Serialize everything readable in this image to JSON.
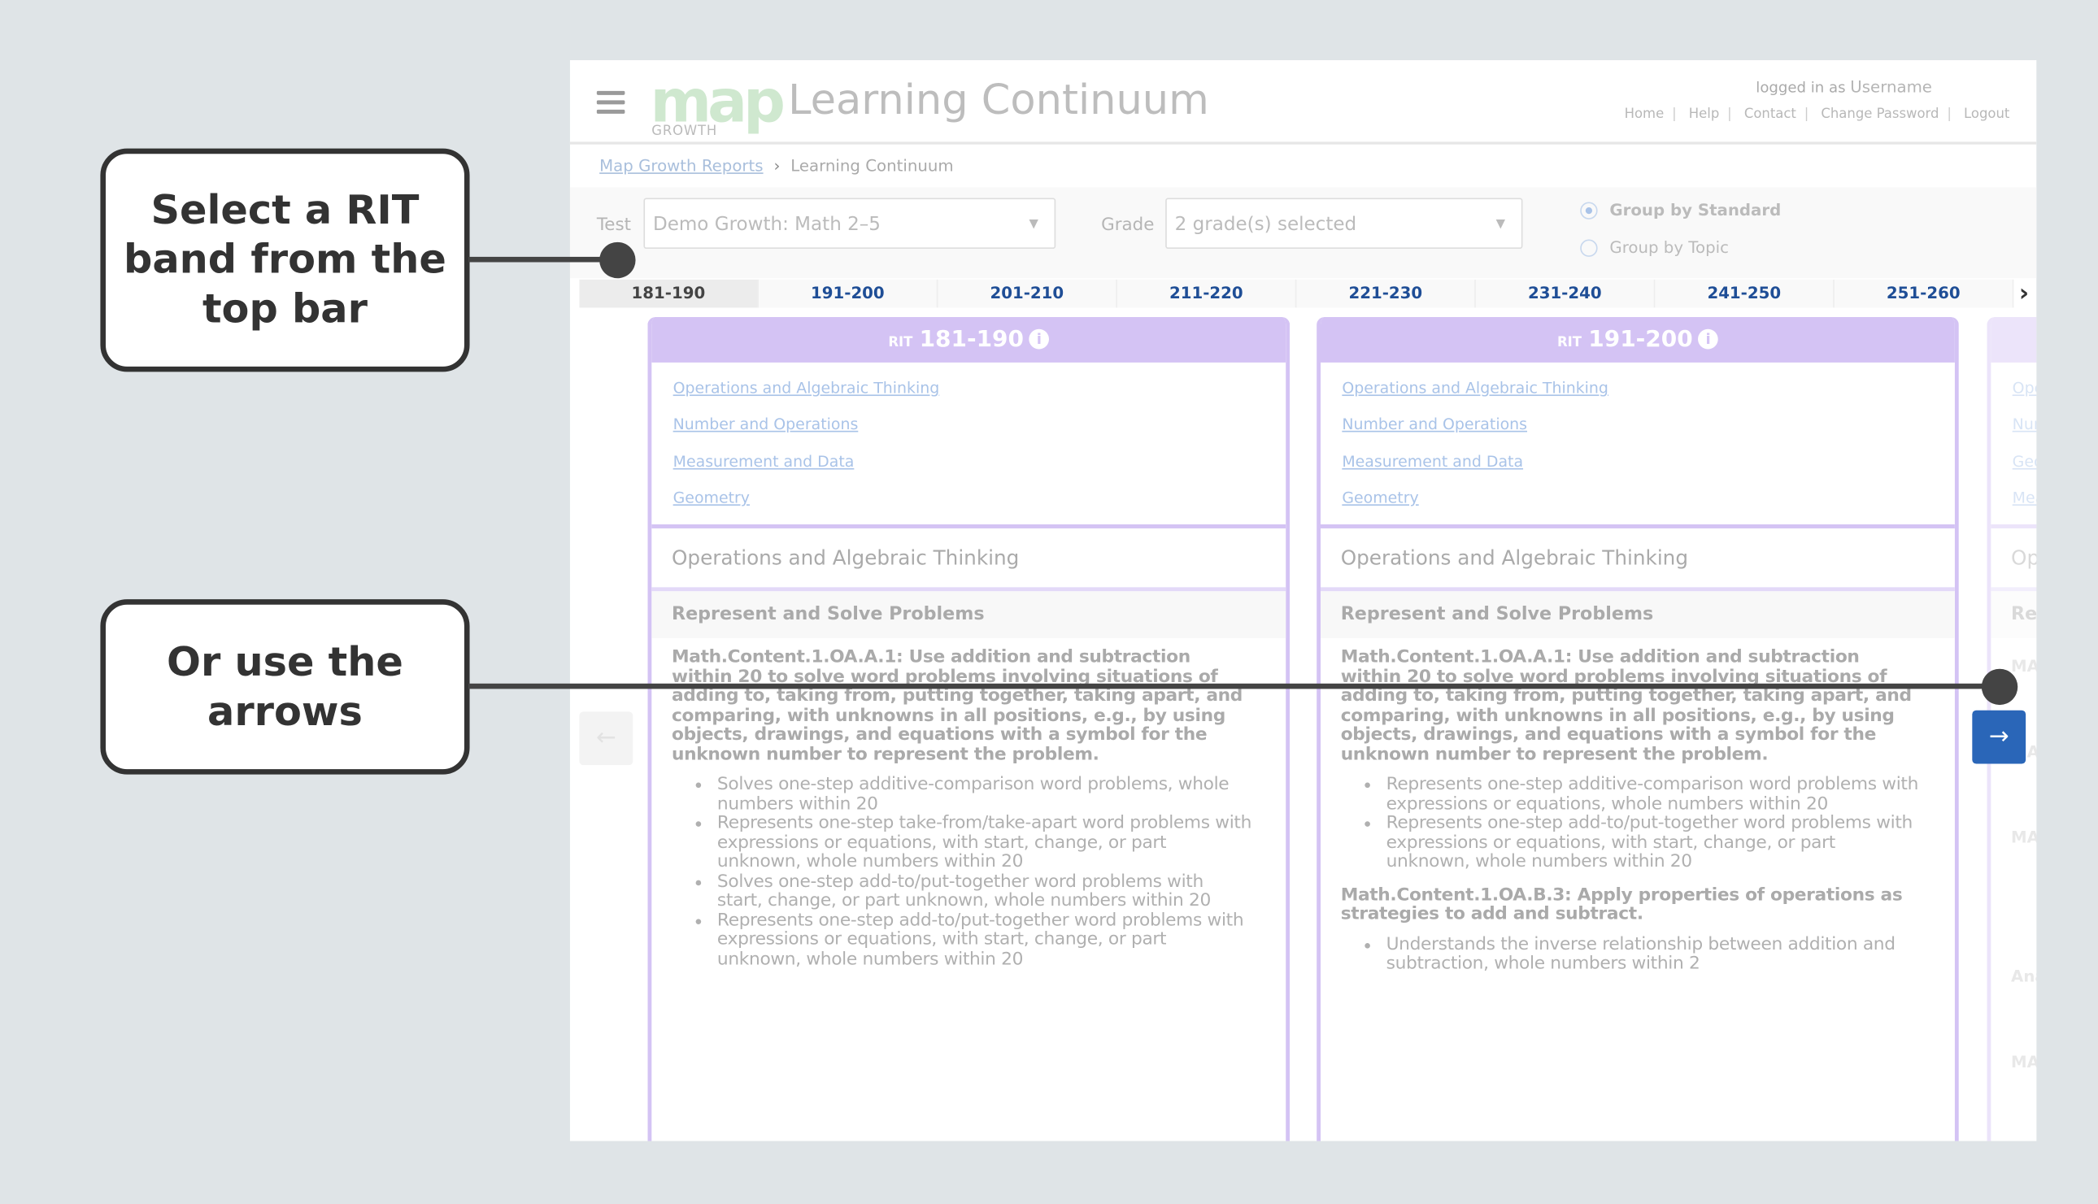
{
  "callouts": {
    "top": "Select a RIT band from the top bar",
    "bottom": "Or use the arrows"
  },
  "header": {
    "logo": "map",
    "logo_sub": "GROWTH",
    "title": "Learning Continuum",
    "logged_in_prefix": "logged in as",
    "username": "Username",
    "links": [
      "Home",
      "Help",
      "Contact",
      "Change Password",
      "Logout"
    ]
  },
  "breadcrumb": {
    "parent": "Map Growth Reports",
    "current": "Learning Continuum"
  },
  "filters": {
    "test_label": "Test",
    "test_value": "Demo Growth:  Math 2–5",
    "grade_label": "Grade",
    "grade_value": "2 grade(s) selected",
    "group_by_standard": "Group by Standard",
    "group_by_topic": "Group by Topic",
    "selected_group": "Group by Standard"
  },
  "rit_tabs": [
    "181-190",
    "191-200",
    "201-210",
    "211-220",
    "221-230",
    "231-240",
    "241-250",
    "251-260"
  ],
  "active_tab": "181-190",
  "cards": [
    {
      "rit_prefix": "RIT",
      "band": "181-190",
      "links": [
        "Operations and Algebraic Thinking",
        "Number and Operations",
        "Measurement and Data",
        "Geometry"
      ],
      "section": "Operations and Algebraic Thinking",
      "subsection": "Represent and Solve Problems",
      "standards": [
        {
          "title": "Math.Content.1.OA.A.1: Use addition and subtraction within 20 to solve word problems involving situations of adding to, taking from, putting together, taking apart, and comparing, with unknowns in all positions, e.g., by using objects, drawings, and equations with a symbol for the unknown number to represent the problem.",
          "items": [
            "Solves one-step additive-comparison word problems, whole numbers within 20",
            "Represents one-step take-from/take-apart word problems with expressions or equations, with start, change, or part unknown, whole numbers within 20",
            "Solves one-step add-to/put-together word problems with start, change, or part unknown, whole numbers within 20",
            "Represents one-step add-to/put-together word problems with expressions or equations, with start, change, or part unknown, whole numbers within 20"
          ]
        }
      ]
    },
    {
      "rit_prefix": "RIT",
      "band": "191-200",
      "links": [
        "Operations and Algebraic Thinking",
        "Number and Operations",
        "Measurement and Data",
        "Geometry"
      ],
      "section": "Operations and Algebraic Thinking",
      "subsection": "Represent and Solve Problems",
      "standards": [
        {
          "title": "Math.Content.1.OA.A.1: Use addition and subtraction within 20 to solve word problems involving situations of adding to, taking from, putting together, taking apart, and comparing, with unknowns in all positions, e.g., by using objects, drawings, and equations with a symbol for the unknown number to represent the problem.",
          "items": [
            "Represents one-step additive-comparison word problems with expressions or equations, whole numbers within 20",
            "Represents one-step add-to/put-together word problems with expressions or equations, with start, change, or part unknown, whole numbers within 20"
          ]
        },
        {
          "title": "Math.Content.1.OA.B.3: Apply properties of operations as strategies to add and subtract.",
          "items": [
            "Understands the inverse relationship between addition and subtraction, whole numbers within 2"
          ]
        }
      ]
    }
  ],
  "partial_card": {
    "links": [
      "Ope",
      "Nur",
      "Geo",
      "Mea"
    ],
    "section": "Op",
    "subsection": "Rep",
    "fragments": [
      "MA",
      "MA",
      "MA",
      "Ana",
      "MA"
    ]
  },
  "icons": {
    "menu": "hamburger-icon",
    "info": "info-icon",
    "next_tabs": "chevron-right-icon",
    "prev": "arrow-left-icon",
    "next": "arrow-right-icon"
  },
  "colors": {
    "accent_purple": "#d4c3f4",
    "button_blue": "#2a66b8",
    "tab_text": "#1f4e96",
    "logo_green": "#cfe8cf"
  }
}
